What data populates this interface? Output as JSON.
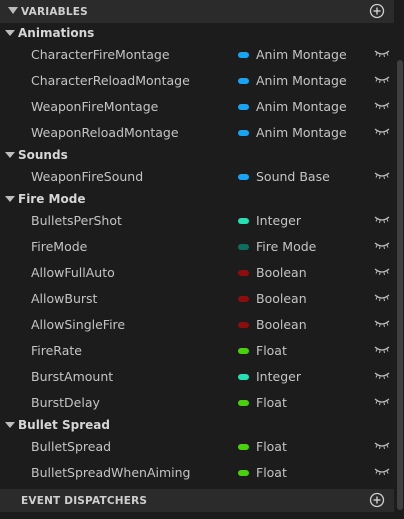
{
  "sections": {
    "variables": {
      "title": "VARIABLES"
    },
    "dispatchers": {
      "title": "EVENT DISPATCHERS"
    }
  },
  "categories": {
    "animations": "Animations",
    "sounds": "Sounds",
    "fire_mode": "Fire Mode",
    "bullet_spread": "Bullet Spread"
  },
  "variables": [
    {
      "name": "CharacterFireMontage",
      "type": "Anim Montage",
      "color": "#1aa3f0"
    },
    {
      "name": "CharacterReloadMontage",
      "type": "Anim Montage",
      "color": "#1aa3f0"
    },
    {
      "name": "WeaponFireMontage",
      "type": "Anim Montage",
      "color": "#1aa3f0"
    },
    {
      "name": "WeaponReloadMontage",
      "type": "Anim Montage",
      "color": "#1aa3f0"
    },
    {
      "name": "WeaponFireSound",
      "type": "Sound Base",
      "color": "#1aa3f0"
    },
    {
      "name": "BulletsPerShot",
      "type": "Integer",
      "color": "#27dfb3"
    },
    {
      "name": "FireMode",
      "type": "Fire Mode",
      "color": "#0e6d60"
    },
    {
      "name": "AllowFullAuto",
      "type": "Boolean",
      "color": "#8b0d0d"
    },
    {
      "name": "AllowBurst",
      "type": "Boolean",
      "color": "#8b0d0d"
    },
    {
      "name": "AllowSingleFire",
      "type": "Boolean",
      "color": "#8b0d0d"
    },
    {
      "name": "FireRate",
      "type": "Float",
      "color": "#4bd00f"
    },
    {
      "name": "BurstAmount",
      "type": "Integer",
      "color": "#27dfb3"
    },
    {
      "name": "BurstDelay",
      "type": "Float",
      "color": "#4bd00f"
    },
    {
      "name": "BulletSpread",
      "type": "Float",
      "color": "#4bd00f"
    },
    {
      "name": "BulletSpreadWhenAiming",
      "type": "Float",
      "color": "#4bd00f"
    }
  ],
  "icons": {
    "add": "plus-circle-icon",
    "visibility": "eye-closed-icon",
    "collapse": "triangle-down-icon"
  }
}
